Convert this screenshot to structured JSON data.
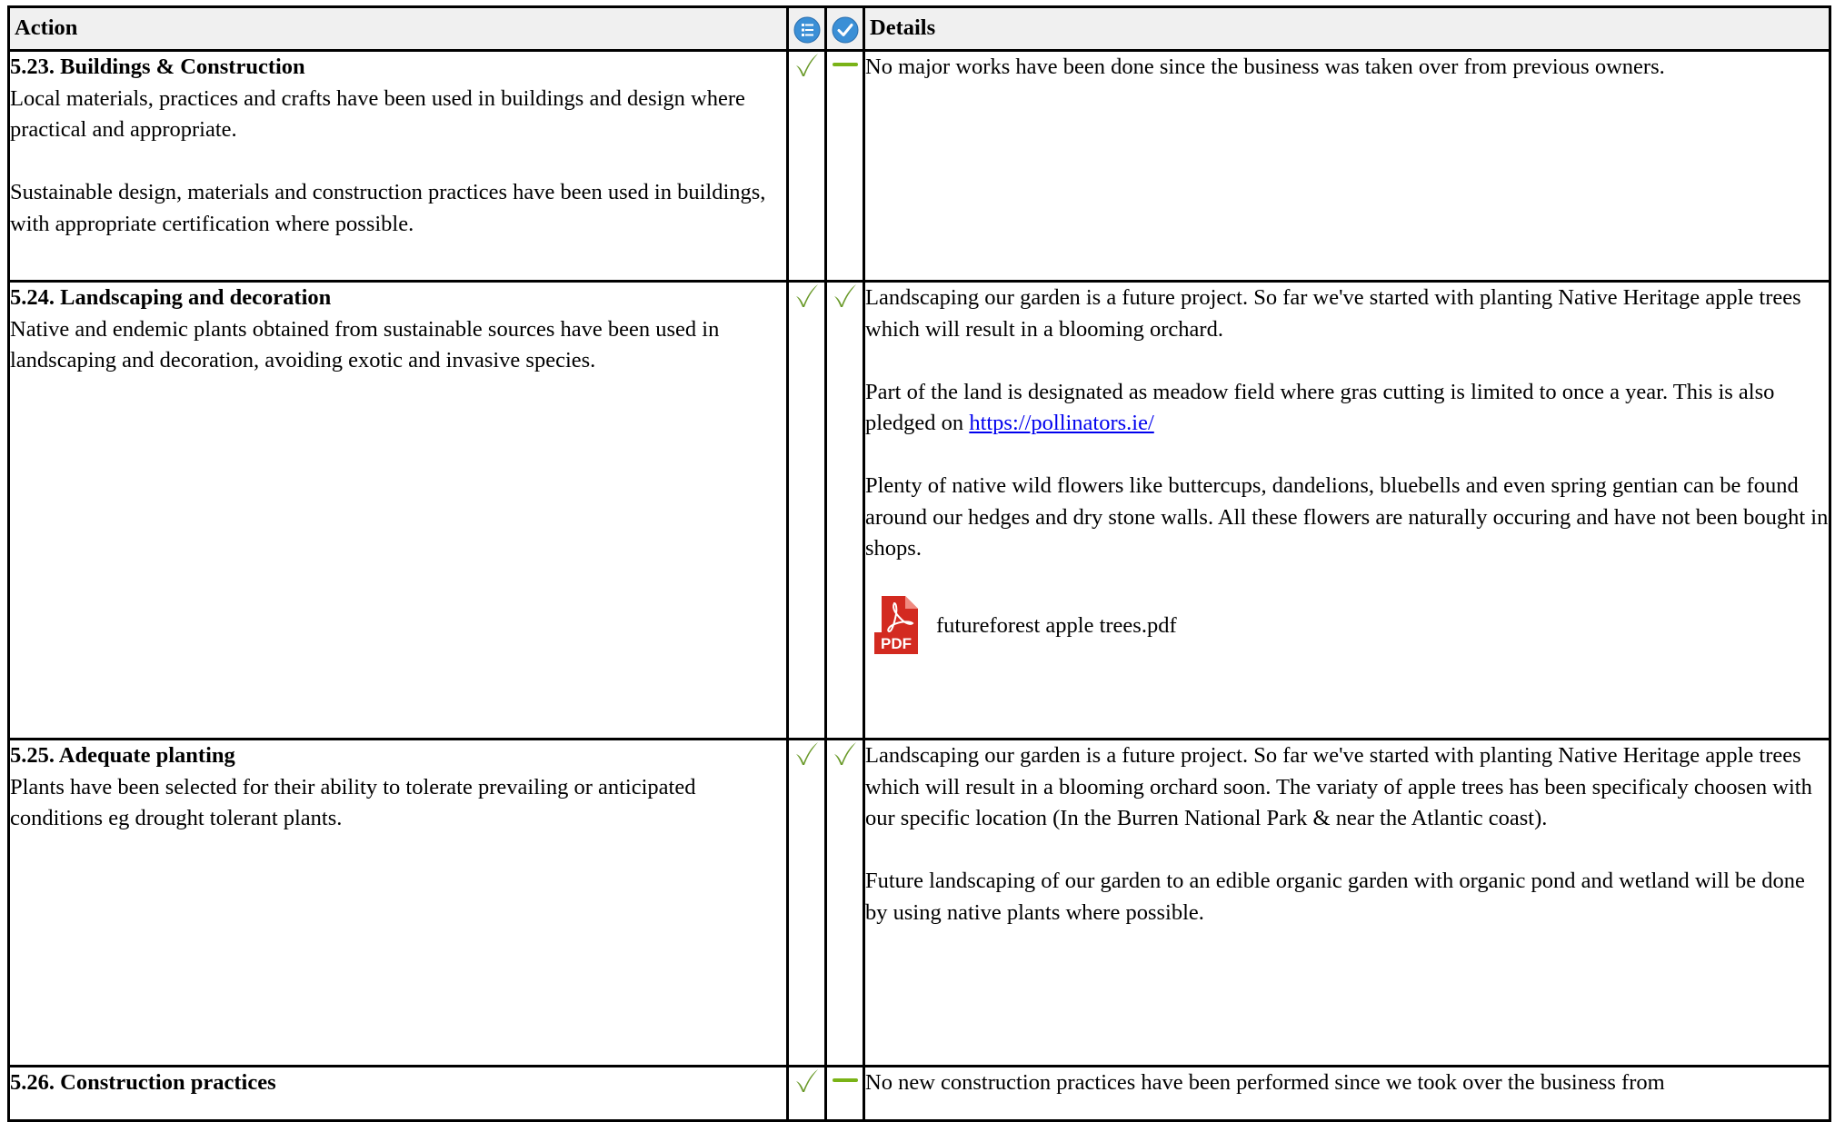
{
  "table": {
    "headers": {
      "action": "Action",
      "details": "Details"
    },
    "header_icons": [
      "list-info-icon",
      "check-circle-icon"
    ],
    "colors": {
      "check_green": "#6a9a2a",
      "dash_green": "#7ab317",
      "header_icon_blue": "#3a8fd6",
      "header_bg": "#f0f0f0",
      "link": "#0000ee",
      "pdf_red": "#d32a20"
    },
    "rows": [
      {
        "title": "5.23. Buildings & Construction",
        "description": "Local materials, practices and crafts have been used in buildings and design where practical and appropriate.\n\nSustainable design, materials and construction practices have been used in buildings, with appropriate certification where possible.",
        "status_1": "check-icon",
        "status_2": "dash-icon",
        "details": [
          {
            "text": "No major works have been done since the business was taken over from previous owners."
          }
        ]
      },
      {
        "title": "5.24. Landscaping and decoration",
        "description": "Native and endemic plants obtained from sustainable sources have been used in landscaping and decoration, avoiding exotic and invasive species.",
        "status_1": "check-icon",
        "status_2": "check-icon",
        "details": [
          {
            "text": "Landscaping our garden is a future project. So far we've started with planting Native Heritage apple trees which will result in a blooming orchard."
          },
          {
            "text": "Part of the land is designated as meadow field where gras cutting is limited to once a year. This is also pledged on ",
            "link": "https://pollinators.ie/"
          },
          {
            "text": "Plenty of native wild flowers like buttercups, dandelions, bluebells and even spring gentian can be found around our hedges and dry stone walls. All these flowers are naturally occuring and have not been bought in shops."
          }
        ],
        "attachment": {
          "icon": "pdf-file-icon",
          "icon_label": "PDF",
          "filename": "futureforest apple trees.pdf"
        }
      },
      {
        "title": "5.25. Adequate planting",
        "description": "Plants have been selected for their ability to tolerate prevailing or anticipated conditions eg drought tolerant plants.",
        "status_1": "check-icon",
        "status_2": "check-icon",
        "details": [
          {
            "text": "Landscaping our garden is a future project. So far we've started with planting Native Heritage apple trees which will result in a blooming orchard soon. The variaty of apple trees has been specificaly choosen with our specific location (In the Burren National Park & near the Atlantic coast)."
          },
          {
            "text": "Future landscaping of our garden to an edible organic garden with organic pond and wetland will be done by using native plants where  possible."
          }
        ]
      },
      {
        "title": "5.26. Construction practices",
        "description": "",
        "status_1": "check-icon",
        "status_2": "dash-icon",
        "details": [
          {
            "text": "No new construction practices have been performed since we took over the business from"
          }
        ]
      }
    ]
  }
}
